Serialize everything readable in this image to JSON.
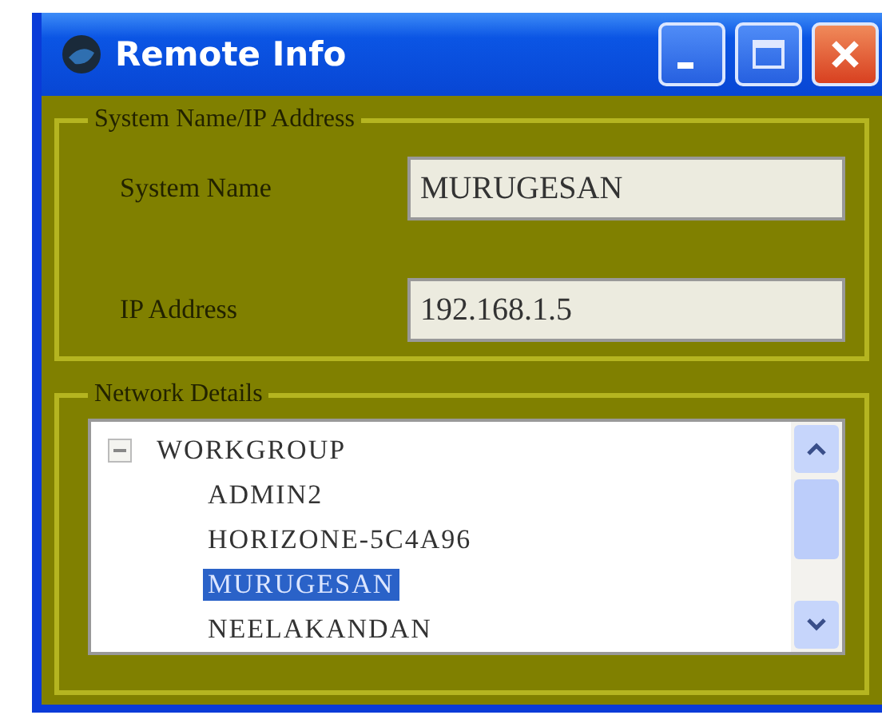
{
  "window": {
    "title": "Remote Info"
  },
  "system_group": {
    "title": "System Name/IP Address",
    "fields": [
      {
        "label": "System Name",
        "value": "MURUGESAN"
      },
      {
        "label": "IP Address",
        "value": "192.168.1.5"
      }
    ]
  },
  "network_group": {
    "title": "Network Details",
    "tree": [
      {
        "label": "WORKGROUP",
        "expanded": true,
        "selected": false,
        "children": [
          {
            "label": "ADMIN2",
            "selected": false
          },
          {
            "label": "HORIZONE-5C4A96",
            "selected": false
          },
          {
            "label": "MURUGESAN",
            "selected": true
          },
          {
            "label": "NEELAKANDAN",
            "selected": false
          }
        ]
      }
    ]
  }
}
